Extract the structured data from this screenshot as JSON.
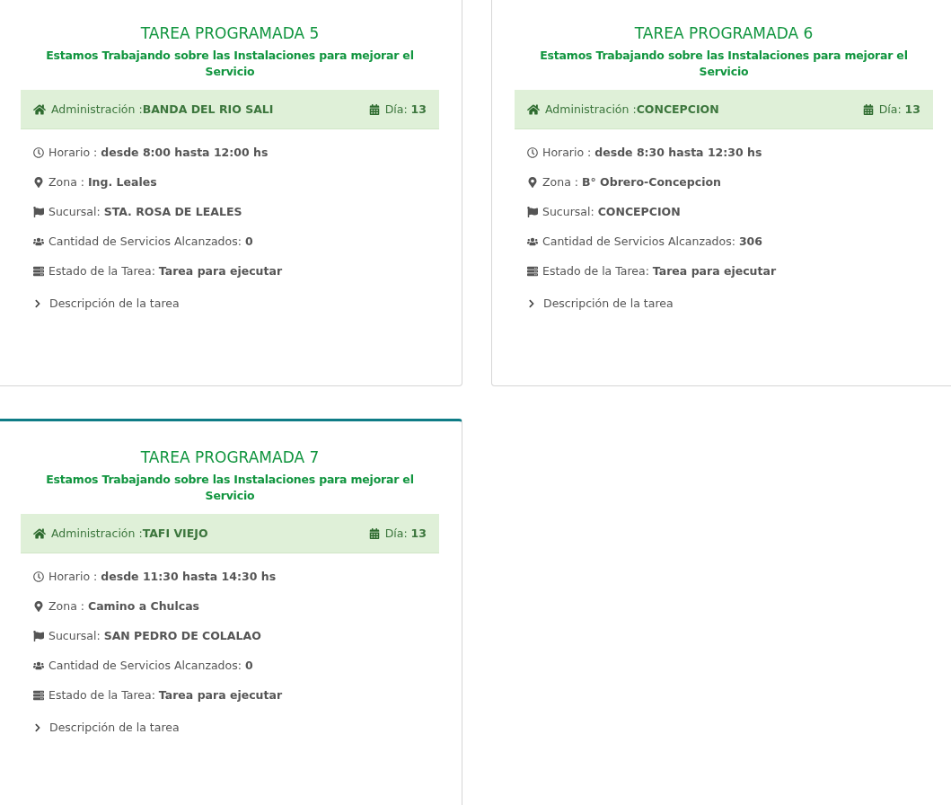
{
  "cards": [
    {
      "title": "TAREA PROGRAMADA 5",
      "subtitle": "Estamos Trabajando sobre las Instalaciones para mejorar el Servicio",
      "admin": "Administración :**BANDA DEL RIO SALI**",
      "day": "Día: **13**",
      "rows": [
        {
          "kind": "time",
          "text": "Horario : **desde 8:00 hasta 12:00 hs**"
        },
        {
          "kind": "zone",
          "text": "Zona : **Ing. Leales**"
        },
        {
          "kind": "branch",
          "text": "Sucursal: **STA. ROSA DE LEALES**"
        },
        {
          "kind": "count",
          "text": "Cantidad de Servicios Alcanzados: **0**"
        },
        {
          "kind": "status",
          "text": "Estado de la Tarea: **Tarea para ejecutar**"
        }
      ],
      "description": {
        "label": "Descripción de la tarea",
        "expanded": false
      }
    },
    {
      "title": "TAREA PROGRAMADA 6",
      "subtitle": "Estamos Trabajando sobre las Instalaciones para mejorar el Servicio",
      "admin": "Administración :**CONCEPCION**",
      "day": "Día: **13**",
      "rows": [
        {
          "kind": "time",
          "text": "Horario : **desde 8:30 hasta 12:30 hs**"
        },
        {
          "kind": "zone",
          "text": "Zona : **B° Obrero-Concepcion**"
        },
        {
          "kind": "branch",
          "text": "Sucursal: **CONCEPCION**"
        },
        {
          "kind": "count",
          "text": "Cantidad de Servicios Alcanzados: **306**"
        },
        {
          "kind": "status",
          "text": "Estado de la Tarea: **Tarea para ejecutar**"
        }
      ],
      "description": {
        "label": "Descripción de la tarea",
        "expanded": false
      }
    },
    {
      "title": "TAREA PROGRAMADA 7",
      "subtitle": "Estamos Trabajando sobre las Instalaciones para mejorar el Servicio",
      "admin": "Administración :**TAFI VIEJO**",
      "day": "Día: **13**",
      "rows": [
        {
          "kind": "time",
          "text": "Horario : **desde 11:30 hasta 14:30 hs**"
        },
        {
          "kind": "zone",
          "text": "Zona : **Camino a Chulcas**"
        },
        {
          "kind": "branch",
          "text": "Sucursal: **SAN PEDRO DE COLALAO**"
        },
        {
          "kind": "count",
          "text": "Cantidad de Servicios Alcanzados: **0**"
        },
        {
          "kind": "status",
          "text": "Estado de la Tarea: **Tarea para ejecutar**"
        }
      ],
      "description": {
        "label": "Descripción de la tarea",
        "expanded": false
      }
    }
  ]
}
